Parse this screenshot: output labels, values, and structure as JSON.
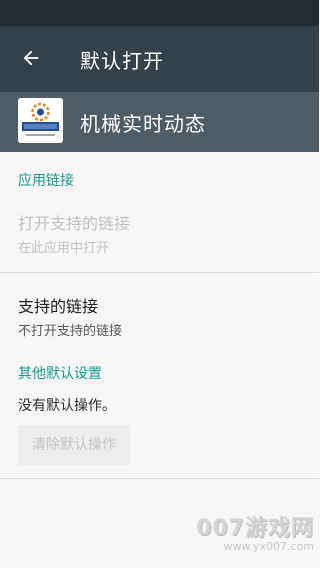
{
  "toolbar": {
    "title": "默认打开",
    "back_icon": "arrow-back-icon"
  },
  "app": {
    "name": "机械实时动态",
    "icon": "app-logo"
  },
  "app_links": {
    "section_label": "应用链接",
    "open_supported_links": {
      "title": "打开支持的链接",
      "summary": "在此应用中打开"
    }
  },
  "supported_links": {
    "title": "支持的链接",
    "summary": "不打开支持的链接"
  },
  "other_defaults": {
    "section_label": "其他默认设置",
    "status": "没有默认操作。",
    "clear_button": "清除默认操作"
  },
  "watermark": {
    "main": "007游戏网",
    "url": "www.yx007.com"
  },
  "colors": {
    "status_bar": "#232c33",
    "toolbar": "#35414a",
    "app_header": "#4f5c66",
    "accent": "#1d9a8e"
  }
}
